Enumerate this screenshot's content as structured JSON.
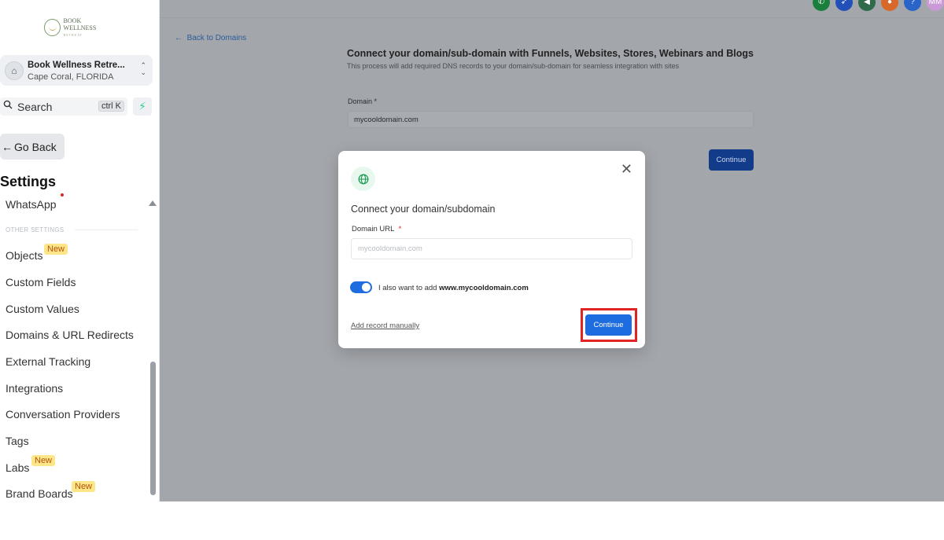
{
  "sidebar": {
    "logo": {
      "line1": "BOOK WELLNESS",
      "line2": "RETREAT"
    },
    "account": {
      "name": "Book Wellness Retre...",
      "location": "Cape Coral, FLORIDA"
    },
    "search": {
      "label": "Search",
      "shortcut": "ctrl K"
    },
    "go_back": "Go Back",
    "settings_title": "Settings",
    "items_top": [
      {
        "label": "WhatsApp"
      }
    ],
    "other_settings_label": "OTHER SETTINGS",
    "items": [
      {
        "label": "Objects",
        "badge": "New"
      },
      {
        "label": "Custom Fields"
      },
      {
        "label": "Custom Values"
      },
      {
        "label": "Domains & URL Redirects"
      },
      {
        "label": "External Tracking"
      },
      {
        "label": "Integrations"
      },
      {
        "label": "Conversation Providers"
      },
      {
        "label": "Tags"
      },
      {
        "label": "Labs",
        "badge": "New"
      },
      {
        "label": "Brand Boards",
        "badge": "New"
      }
    ]
  },
  "header": {
    "icons": [
      {
        "name": "phone-icon",
        "color": "#1a7f3c"
      },
      {
        "name": "rocket-icon",
        "color": "#2350b8"
      },
      {
        "name": "megaphone-icon",
        "color": "#2f6b4a"
      },
      {
        "name": "bell-icon",
        "color": "#d9692a"
      },
      {
        "name": "help-icon",
        "color": "#2a64c8"
      },
      {
        "name": "avatar",
        "label": "MM",
        "color": "#c99ad6"
      }
    ]
  },
  "page": {
    "back_link": "Back to Domains",
    "title": "Connect your domain/sub-domain with Funnels, Websites, Stores, Webinars and Blogs",
    "subtitle": "This process will add required DNS records to your domain/sub-domain for seamless integration with sites",
    "domain_label": "Domain",
    "domain_value": "mycooldomain.com",
    "continue_label": "Continue"
  },
  "modal": {
    "title": "Connect your domain/subdomain",
    "field_label": "Domain URL",
    "field_placeholder": "mycooldomain.com",
    "toggle_text_prefix": "I also want to add",
    "toggle_text_domain": "www.mycooldomain.com",
    "toggle_on": true,
    "add_manual_label": "Add record manually",
    "continue_label": "Continue"
  },
  "colors": {
    "accent": "#1d6de0",
    "highlight": "#e02424",
    "badge_bg": "#fde68a",
    "overlay": "#a3a6ab"
  }
}
